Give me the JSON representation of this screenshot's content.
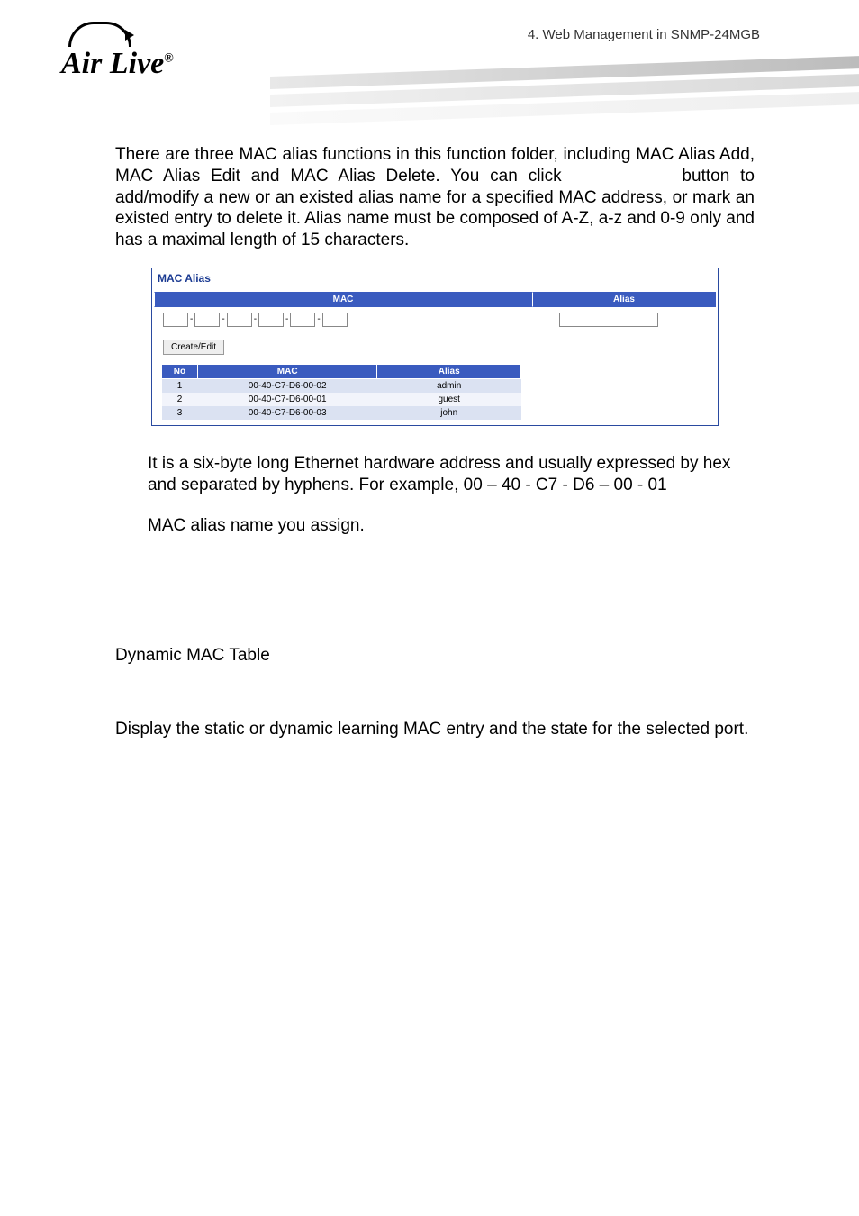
{
  "header": {
    "breadcrumb": "4.  Web  Management  in  SNMP-24MGB",
    "logo_text": "Air Live",
    "logo_reg": "®"
  },
  "intro_paragraph_prefix": "There are three MAC alias functions in this function folder, including MAC Alias Add, MAC Alias Edit and MAC Alias Delete. You can click ",
  "intro_paragraph_suffix": " button to add/modify a new or an existed alias name for a specified MAC address, or mark an existed entry to delete it. Alias name must be composed of A-Z, a-z and 0-9 only and has a maximal length of 15 characters.",
  "panel": {
    "title": "MAC Alias",
    "hdr_mac": "MAC",
    "hdr_alias": "Alias",
    "sep": "-",
    "create_edit": "Create/Edit",
    "table": {
      "col_no": "No",
      "col_mac": "MAC",
      "col_alias": "Alias",
      "rows": [
        {
          "no": "1",
          "mac": "00-40-C7-D6-00-02",
          "alias": "admin"
        },
        {
          "no": "2",
          "mac": "00-40-C7-D6-00-01",
          "alias": "guest"
        },
        {
          "no": "3",
          "mac": "00-40-C7-D6-00-03",
          "alias": "john"
        }
      ]
    }
  },
  "desc_mac": "It is a six-byte long Ethernet hardware address and usually expressed by hex and separated by hyphens. For example, 00 – 40 - C7 - D6 – 00 - 01",
  "desc_alias": "MAC alias name you assign.",
  "section_title": "Dynamic MAC Table",
  "func_desc": "Display the static or dynamic learning MAC entry and the state for the selected port."
}
